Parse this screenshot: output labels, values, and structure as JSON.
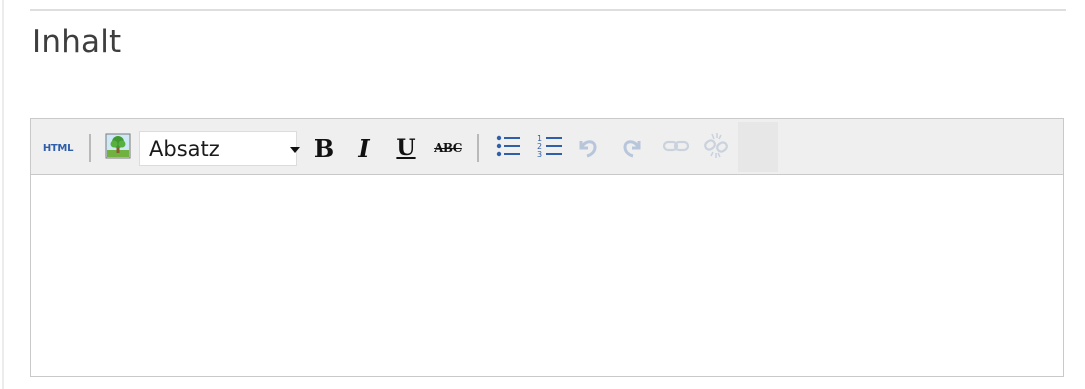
{
  "section": {
    "title": "Inhalt"
  },
  "editor": {
    "toolbar": {
      "html_label": "HTML",
      "format_select": {
        "selected": "Absatz"
      },
      "bold_label": "B",
      "italic_label": "I",
      "underline_label": "U",
      "strike_label": "ABC",
      "icons": {
        "image": "image-icon",
        "dropdown": "chevron-down-icon",
        "bullet_list": "bullet-list-icon",
        "numbered_list": "numbered-list-icon",
        "undo": "undo-icon",
        "redo": "redo-icon",
        "link": "link-icon",
        "unlink": "unlink-icon"
      }
    },
    "content": ""
  },
  "colors": {
    "accent_blue": "#2f5fa8",
    "disabled_icon": "#b8c6dc",
    "toolbar_bg": "#efefef",
    "border": "#c9c9c9",
    "title_text": "#3e3e3e"
  }
}
